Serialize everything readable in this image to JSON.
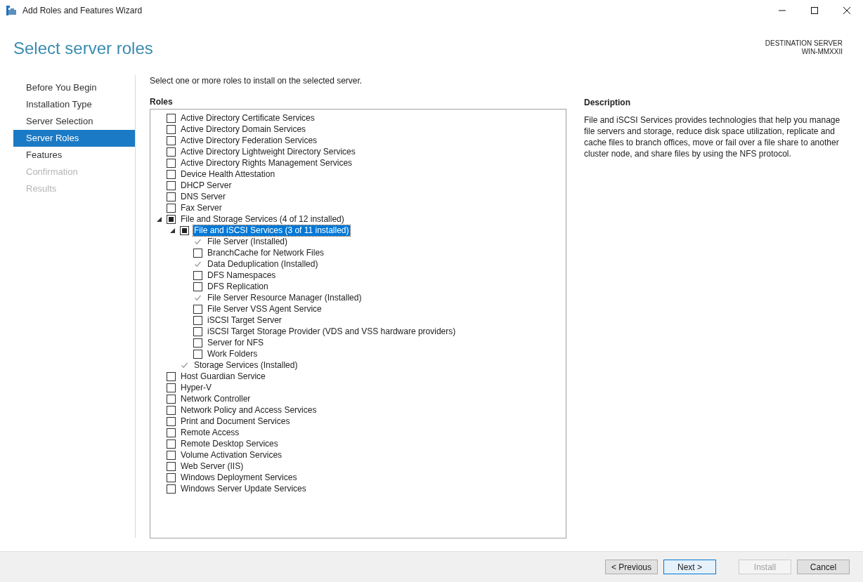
{
  "window": {
    "title": "Add Roles and Features Wizard"
  },
  "page_title": "Select server roles",
  "destination": {
    "label": "DESTINATION SERVER",
    "server": "WIN-MMXXII"
  },
  "steps": [
    {
      "label": "Before You Begin",
      "selected": false,
      "disabled": false
    },
    {
      "label": "Installation Type",
      "selected": false,
      "disabled": false
    },
    {
      "label": "Server Selection",
      "selected": false,
      "disabled": false
    },
    {
      "label": "Server Roles",
      "selected": true,
      "disabled": false
    },
    {
      "label": "Features",
      "selected": false,
      "disabled": false
    },
    {
      "label": "Confirmation",
      "selected": false,
      "disabled": true
    },
    {
      "label": "Results",
      "selected": false,
      "disabled": true
    }
  ],
  "instruction": "Select one or more roles to install on the selected server.",
  "roles_heading": "Roles",
  "roles": [
    {
      "label": "Active Directory Certificate Services",
      "checked": false,
      "partial": false,
      "disabled": false,
      "selected": false
    },
    {
      "label": "Active Directory Domain Services",
      "checked": false,
      "partial": false,
      "disabled": false,
      "selected": false
    },
    {
      "label": "Active Directory Federation Services",
      "checked": false,
      "partial": false,
      "disabled": false,
      "selected": false
    },
    {
      "label": "Active Directory Lightweight Directory Services",
      "checked": false,
      "partial": false,
      "disabled": false,
      "selected": false
    },
    {
      "label": "Active Directory Rights Management Services",
      "checked": false,
      "partial": false,
      "disabled": false,
      "selected": false
    },
    {
      "label": "Device Health Attestation",
      "checked": false,
      "partial": false,
      "disabled": false,
      "selected": false
    },
    {
      "label": "DHCP Server",
      "checked": false,
      "partial": false,
      "disabled": false,
      "selected": false
    },
    {
      "label": "DNS Server",
      "checked": false,
      "partial": false,
      "disabled": false,
      "selected": false
    },
    {
      "label": "Fax Server",
      "checked": false,
      "partial": false,
      "disabled": false,
      "selected": false
    },
    {
      "label": "File and Storage Services (4 of 12 installed)",
      "checked": false,
      "partial": true,
      "disabled": false,
      "selected": false,
      "expanded": true,
      "children": [
        {
          "label": "File and iSCSI Services (3 of 11 installed)",
          "checked": false,
          "partial": true,
          "disabled": false,
          "selected": true,
          "expanded": true,
          "children": [
            {
              "label": "File Server (Installed)",
              "checked": true,
              "partial": false,
              "disabled": true,
              "selected": false
            },
            {
              "label": "BranchCache for Network Files",
              "checked": false,
              "partial": false,
              "disabled": false,
              "selected": false
            },
            {
              "label": "Data Deduplication (Installed)",
              "checked": true,
              "partial": false,
              "disabled": true,
              "selected": false
            },
            {
              "label": "DFS Namespaces",
              "checked": false,
              "partial": false,
              "disabled": false,
              "selected": false
            },
            {
              "label": "DFS Replication",
              "checked": false,
              "partial": false,
              "disabled": false,
              "selected": false
            },
            {
              "label": "File Server Resource Manager (Installed)",
              "checked": true,
              "partial": false,
              "disabled": true,
              "selected": false
            },
            {
              "label": "File Server VSS Agent Service",
              "checked": false,
              "partial": false,
              "disabled": false,
              "selected": false
            },
            {
              "label": "iSCSI Target Server",
              "checked": false,
              "partial": false,
              "disabled": false,
              "selected": false
            },
            {
              "label": "iSCSI Target Storage Provider (VDS and VSS hardware providers)",
              "checked": false,
              "partial": false,
              "disabled": false,
              "selected": false
            },
            {
              "label": "Server for NFS",
              "checked": false,
              "partial": false,
              "disabled": false,
              "selected": false
            },
            {
              "label": "Work Folders",
              "checked": false,
              "partial": false,
              "disabled": false,
              "selected": false
            }
          ]
        },
        {
          "label": "Storage Services (Installed)",
          "checked": true,
          "partial": false,
          "disabled": true,
          "selected": false
        }
      ]
    },
    {
      "label": "Host Guardian Service",
      "checked": false,
      "partial": false,
      "disabled": false,
      "selected": false
    },
    {
      "label": "Hyper-V",
      "checked": false,
      "partial": false,
      "disabled": false,
      "selected": false
    },
    {
      "label": "Network Controller",
      "checked": false,
      "partial": false,
      "disabled": false,
      "selected": false
    },
    {
      "label": "Network Policy and Access Services",
      "checked": false,
      "partial": false,
      "disabled": false,
      "selected": false
    },
    {
      "label": "Print and Document Services",
      "checked": false,
      "partial": false,
      "disabled": false,
      "selected": false
    },
    {
      "label": "Remote Access",
      "checked": false,
      "partial": false,
      "disabled": false,
      "selected": false
    },
    {
      "label": "Remote Desktop Services",
      "checked": false,
      "partial": false,
      "disabled": false,
      "selected": false
    },
    {
      "label": "Volume Activation Services",
      "checked": false,
      "partial": false,
      "disabled": false,
      "selected": false
    },
    {
      "label": "Web Server (IIS)",
      "checked": false,
      "partial": false,
      "disabled": false,
      "selected": false
    },
    {
      "label": "Windows Deployment Services",
      "checked": false,
      "partial": false,
      "disabled": false,
      "selected": false
    },
    {
      "label": "Windows Server Update Services",
      "checked": false,
      "partial": false,
      "disabled": false,
      "selected": false
    }
  ],
  "description": {
    "heading": "Description",
    "text": "File and iSCSI Services provides technologies that help you manage file servers and storage, reduce disk space utilization, replicate and cache files to branch offices, move or fail over a file share to another cluster node, and share files by using the NFS protocol."
  },
  "buttons": [
    {
      "label": "< Previous",
      "disabled": false,
      "focused": false
    },
    {
      "label": "Next >",
      "disabled": false,
      "focused": true
    },
    {
      "label": "Install",
      "disabled": true,
      "focused": false
    },
    {
      "label": "Cancel",
      "disabled": false,
      "focused": false
    }
  ]
}
